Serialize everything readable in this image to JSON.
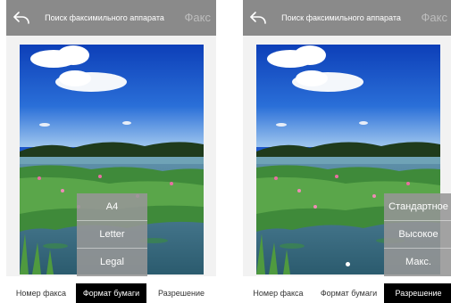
{
  "screens": [
    {
      "header": {
        "title": "Поиск факсимильного аппарата",
        "send_label": "Факс"
      },
      "menu": {
        "items": [
          "A4",
          "Letter",
          "Legal"
        ]
      },
      "tabs": [
        {
          "label": "Номер факса",
          "active": false
        },
        {
          "label": "Формат бумаги",
          "active": true
        },
        {
          "label": "Разрешение",
          "active": false
        }
      ]
    },
    {
      "header": {
        "title": "Поиск факсимильного аппарата",
        "send_label": "Факс"
      },
      "menu": {
        "items": [
          "Стандартное",
          "Высокое",
          "Макс."
        ]
      },
      "tabs": [
        {
          "label": "Номер факса",
          "active": false
        },
        {
          "label": "Формат бумаги",
          "active": false
        },
        {
          "label": "Разрешение",
          "active": true
        }
      ]
    }
  ],
  "icons": {
    "back": "back-arrow-icon"
  },
  "colors": {
    "header_bg": "#8a8a8a",
    "active_tab_bg": "#000000",
    "menu_bg": "#969696"
  }
}
